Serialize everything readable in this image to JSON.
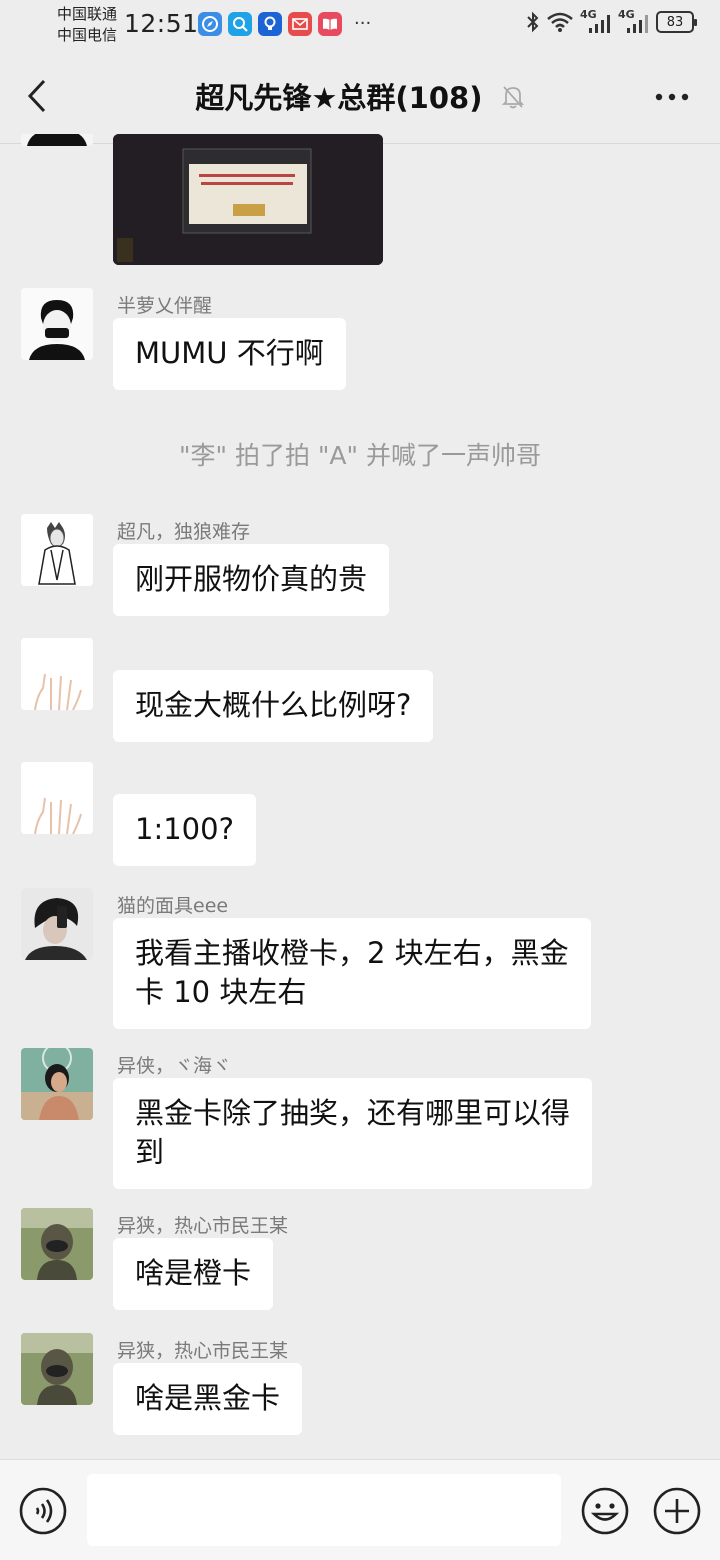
{
  "status_bar": {
    "carrier_1": "中国联通",
    "carrier_2": "中国电信",
    "time": "12:51",
    "notification_icons": [
      "compass-app-icon",
      "search-app-icon",
      "bulb-app-icon",
      "mail-app-icon",
      "book-app-icon"
    ],
    "more": "···",
    "network_1": "4G",
    "network_2": "4G",
    "battery": "83"
  },
  "header": {
    "title": "超凡先锋★总群(108)"
  },
  "messages": [
    {
      "sender": "半萝乂伴醒",
      "text": "MUMU 不行啊"
    },
    {
      "sender": "超凡，独狼难存",
      "text": "刚开服物价真的贵"
    },
    {
      "sender": "",
      "text": "现金大概什么比例呀?"
    },
    {
      "sender": "",
      "text": "1:100?"
    },
    {
      "sender": "猫的面具eee",
      "text_line1": "我看主播收橙卡，2 块左右，黑金",
      "text_line2": "卡 10 块左右"
    },
    {
      "sender": "异侠，ヾ海ヾ",
      "text_line1": "黑金卡除了抽奖，还有哪里可以得",
      "text_line2": "到"
    },
    {
      "sender": "异狭，热心市民王某",
      "text": "啥是橙卡"
    },
    {
      "sender": "异狭，热心市民王某",
      "text": "啥是黑金卡"
    }
  ],
  "system_notice": "\"李\" 拍了拍 \"A\" 并喊了一声帅哥",
  "colors": {
    "background": "#ededed",
    "bubble": "#ffffff",
    "sender_name": "#7a7a7a",
    "system_text": "#9a9a9a"
  }
}
